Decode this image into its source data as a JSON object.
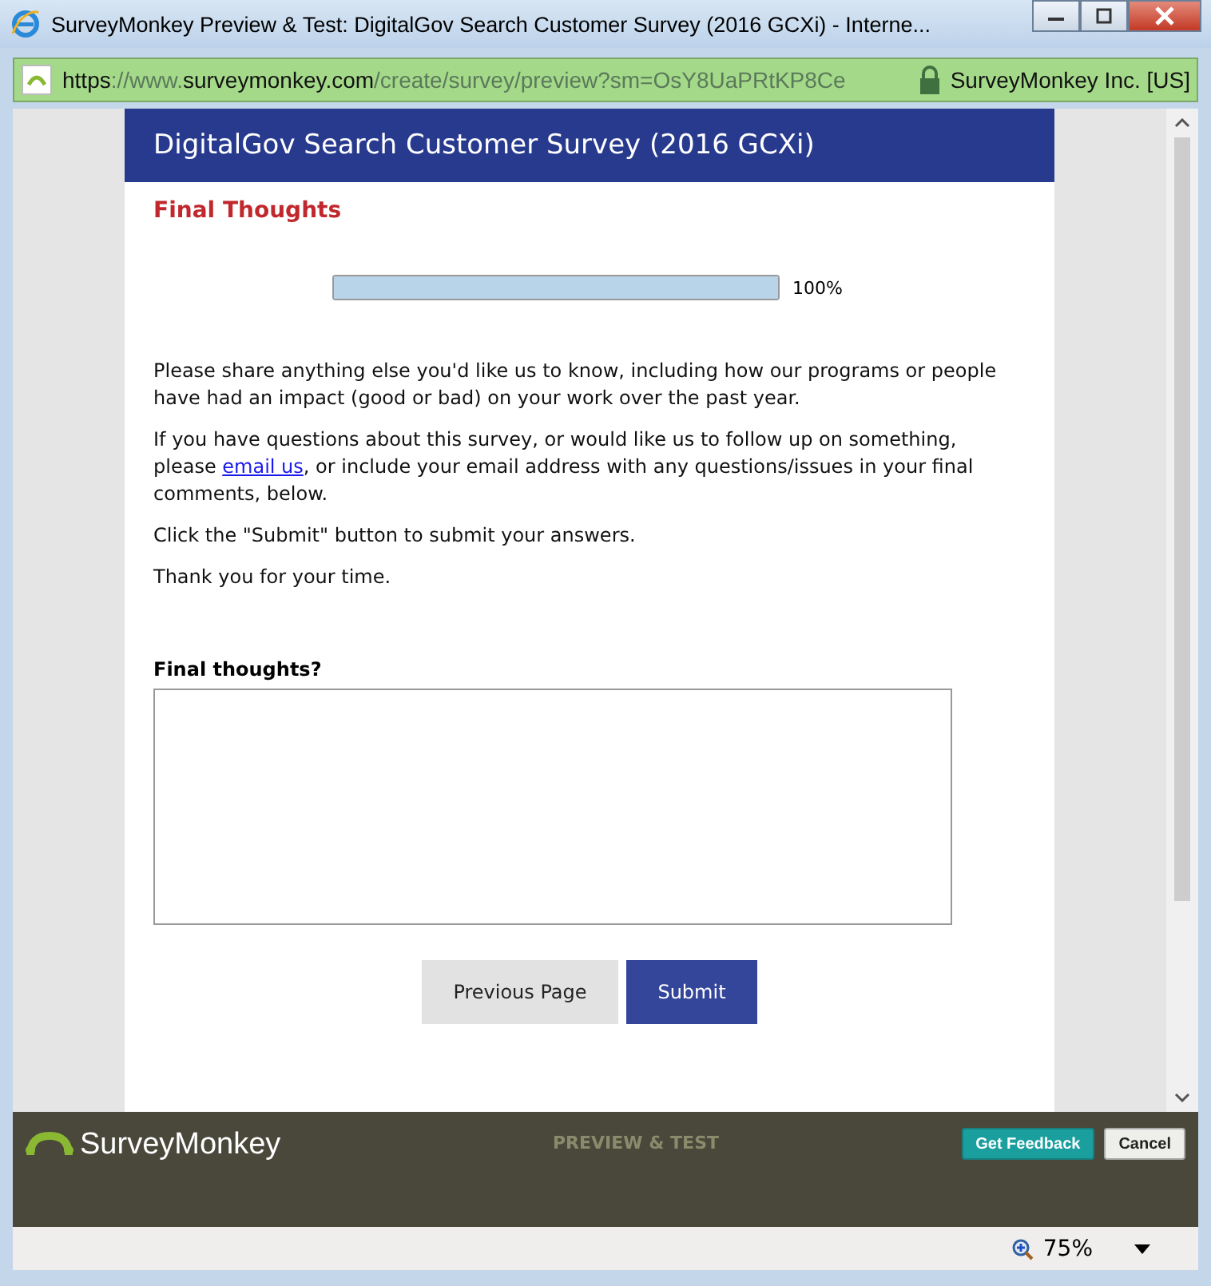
{
  "window": {
    "title": "SurveyMonkey Preview & Test: DigitalGov Search Customer Survey (2016 GCXi) - Interne..."
  },
  "address_bar": {
    "url_parts": [
      {
        "text": "https",
        "emphasis": true
      },
      {
        "text": "://www.",
        "emphasis": false
      },
      {
        "text": "surveymonkey.com",
        "emphasis": true
      },
      {
        "text": "/create/survey/preview?sm=OsY8UaPRtKP8Ce",
        "emphasis": false
      }
    ],
    "certificate": "SurveyMonkey Inc. [US]"
  },
  "survey": {
    "title": "DigitalGov Search Customer Survey (2016 GCXi)",
    "page_title": "Final Thoughts",
    "progress": {
      "level": 1,
      "reading": "100%"
    },
    "paragraphs": [
      {
        "before": "Please share anything else you'd like us to know, including how our programs or people have had an impact (good or bad) on your work over the past year."
      },
      {
        "before": "If you have questions about this survey, or would like us to follow up on something, please ",
        "link": "email us",
        "after": ", or include your email address with any questions/issues in your final comments, below."
      },
      {
        "before": "Click the \"Submit\" button to submit your answers."
      },
      {
        "before": "Thank you for your time."
      }
    ],
    "question": "Final thoughts?",
    "buttons": [
      {
        "label": "Previous Page",
        "kind": "secondary"
      },
      {
        "label": "Submit",
        "kind": "primary"
      }
    ]
  },
  "footer": {
    "brand": "SurveyMonkey",
    "mode": "PREVIEW & TEST",
    "buttons": [
      {
        "label": "Get Feedback",
        "kind": "primary"
      },
      {
        "label": "Cancel",
        "kind": "secondary"
      }
    ]
  },
  "status_bar": {
    "zoom": "75%"
  }
}
